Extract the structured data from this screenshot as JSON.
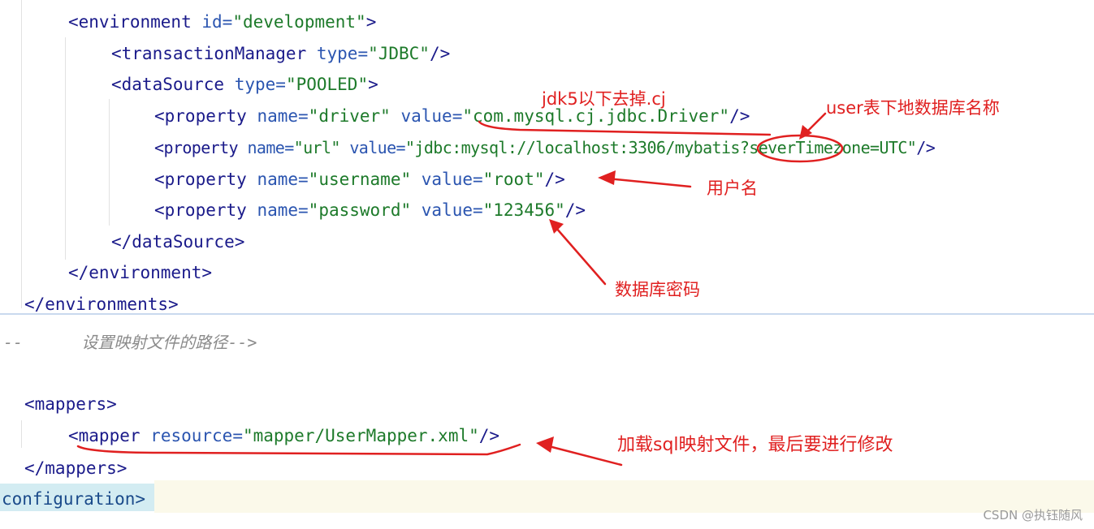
{
  "code_top": {
    "env_open": {
      "tag": "<environment",
      "attr": "id=",
      "val": "\"development\"",
      "close": ">"
    },
    "txn": {
      "tag": "<transactionManager",
      "attr": "type=",
      "val": "\"JDBC\"",
      "close": "/>"
    },
    "ds_open": {
      "tag": "<dataSource",
      "attr": "type=",
      "val": "\"POOLED\"",
      "close": ">"
    },
    "prop_driver": {
      "tag": "<property",
      "attr1": "name=",
      "val1": "\"driver\"",
      "attr2": "value=",
      "val2": "\"com.mysql.cj.jdbc.Driver\"",
      "close": "/>"
    },
    "prop_url": {
      "tag": "<property",
      "attr1": "name=",
      "val1": "\"url\"",
      "attr2": "value=",
      "val2": "\"jdbc:mysql://localhost:3306/mybatis?severTimezone=UTC\"",
      "close": "/>"
    },
    "prop_user": {
      "tag": "<property",
      "attr1": "name=",
      "val1": "\"username\"",
      "attr2": "value=",
      "val2": "\"root\"",
      "close": "/>"
    },
    "prop_pass": {
      "tag": "<property",
      "attr1": "name=",
      "val1": "\"password\"",
      "attr2": "value=",
      "val2": "\"123456\"",
      "close": "/>"
    },
    "ds_close": "</dataSource>",
    "env_close": "</environment>",
    "envs_close": "</environments>"
  },
  "code_bottom": {
    "comment": "--      设置映射文件的路径-->",
    "mappers_open": "<mappers>",
    "mapper": {
      "tag": "<mapper",
      "attr": "resource=",
      "val": "\"mapper/UserMapper.xml\"",
      "close": "/>"
    },
    "mappers_close": "</mappers>",
    "config_close": "configuration>"
  },
  "annotations": {
    "jdk5": "jdk5以下去掉.cj",
    "db_name": "user表下地数据库名称",
    "username": "用户名",
    "password": "数据库密码",
    "mapper_note": "加载sql映射文件，最后要进行修改"
  },
  "watermark": "CSDN @执钰随风",
  "colors": {
    "annotation_red": "#e02020",
    "tag": "#1a1a8a",
    "attr": "#2b55b0",
    "value": "#1d7a2a"
  }
}
